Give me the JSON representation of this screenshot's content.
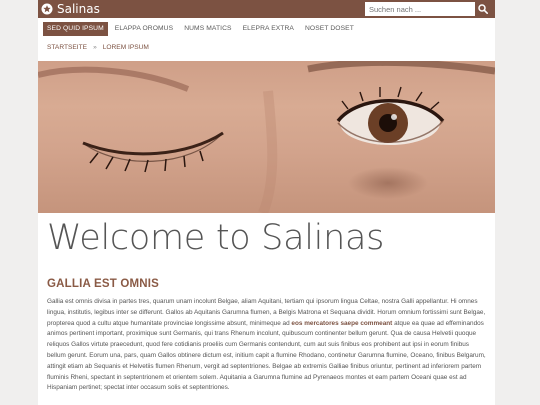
{
  "brand": {
    "name": "Salinas",
    "icon": "star-circle-icon"
  },
  "search": {
    "placeholder": "Suchen nach ...",
    "icon": "search-icon"
  },
  "nav": {
    "items": [
      {
        "label": "SED QUID IPSUM",
        "active": true
      },
      {
        "label": "ELAPPA OROMUS",
        "active": false
      },
      {
        "label": "NUMS MATICS",
        "active": false
      },
      {
        "label": "ELEPRA EXTRA",
        "active": false
      },
      {
        "label": "NOSET DOSET",
        "active": false
      }
    ]
  },
  "breadcrumb": {
    "home": "STARTSEITE",
    "separator": "»",
    "current": "LOREM IPSUM"
  },
  "hero": {
    "description": "close-up photo of a face with one eye closed and one eye open"
  },
  "main": {
    "title": "Welcome to Salinas",
    "section_title": "GALLIA EST OMNIS",
    "body_before": "Gallia est omnis divisa in partes tres, quarum unam incolunt Belgae, aliam Aquitani, tertiam qui ipsorum lingua Celtae, nostra Galli appellantur. Hi omnes lingua, institutis, legibus inter se differunt. Gallos ab Aquitanis Garumna flumen, a Belgis Matrona et Sequana dividit. Horum omnium fortissimi sunt Belgae, propterea quod a cultu atque humanitate provinciae longissime absunt, minimeque ad ",
    "body_bold": "eos mercatores saepe commeant",
    "body_after": " atque ea quae ad effeminandos animos pertinent important, proximique sunt Germanis, qui trans Rhenum incolunt, quibuscum continenter bellum gerunt. Qua de causa Helvetii quoque reliquos Gallos virtute praecedunt, quod fere cotidianis proeliis cum Germanis contendunt, cum aut suis finibus eos prohibent aut ipsi in eorum finibus bellum gerunt. Eorum una, pars, quam Gallos obtinere dictum est, initium capit a flumine Rhodano, continetur Garumna flumine, Oceano, finibus Belgarum, attingit etiam ab Sequanis et Helvetiis flumen Rhenum, vergit ad septentriones. Belgae ab extremis Galliae finibus oriuntur, pertinent ad inferiorem partem fluminis Rheni, spectant in septentrionem et orientem solem. Aquitania a Garumna flumine ad Pyrenaeos montes et eam partem Oceani quae est ad Hispaniam pertinet; spectat inter occasum solis et septentriones."
  },
  "colors": {
    "accent": "#7c5242",
    "background": "#f0efee",
    "page": "#ffffff"
  }
}
